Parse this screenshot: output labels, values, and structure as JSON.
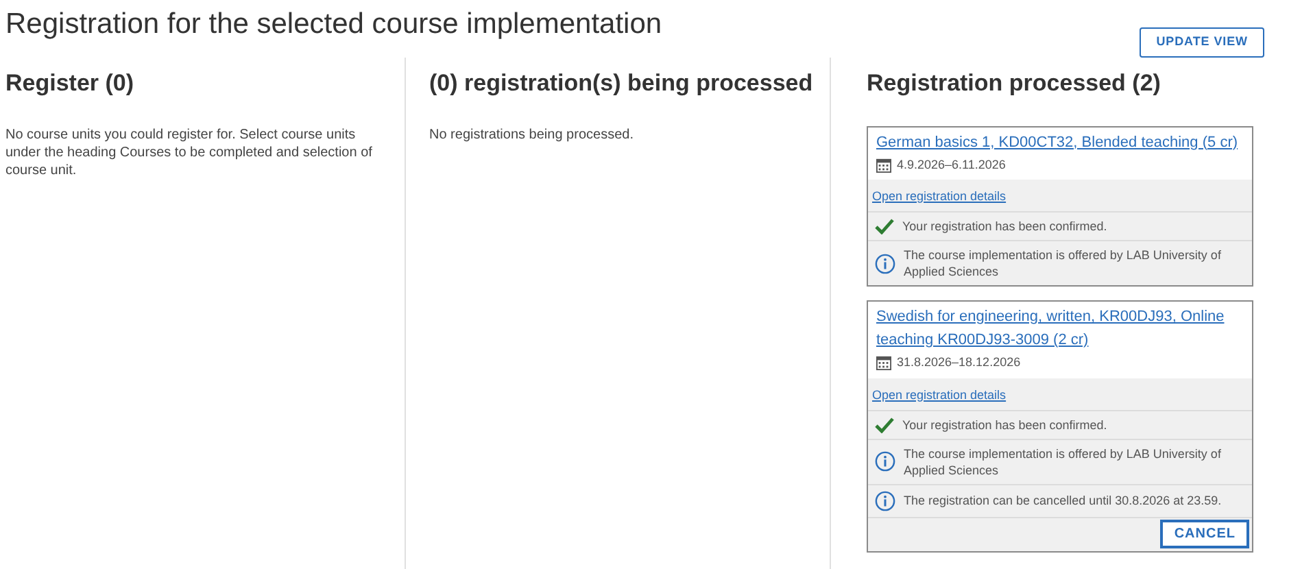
{
  "page_title": "Registration for the selected course implementation",
  "update_button": "UPDATE VIEW",
  "columns": [
    {
      "heading": "Register (0)",
      "message": "No course units you could register for. Select course units under the heading Courses to be completed and selection of course unit."
    },
    {
      "heading": "(0) registration(s) being processed",
      "message": "No registrations being processed."
    },
    {
      "heading": "Registration processed (2)",
      "cards": [
        {
          "title": "German basics 1, KD00CT32, Blended teaching (5 cr)",
          "dates": "4.9.2026–6.11.2026",
          "details_link": "Open registration details",
          "notes": [
            {
              "kind": "confirmed",
              "text": "Your registration has been confirmed."
            },
            {
              "kind": "info",
              "text": "The course implementation is offered by LAB University of Applied Sciences"
            }
          ]
        },
        {
          "title": "Swedish for engineering, written, KR00DJ93, Online teaching KR00DJ93-3009 (2 cr)",
          "dates": "31.8.2026–18.12.2026",
          "details_link": "Open registration details",
          "notes": [
            {
              "kind": "confirmed",
              "text": "Your registration has been confirmed."
            },
            {
              "kind": "info",
              "text": "The course implementation is offered by LAB University of Applied Sciences"
            },
            {
              "kind": "info",
              "text": "The registration can be cancelled until 30.8.2026 at 23.59."
            }
          ],
          "cancel_button": "CANCEL"
        }
      ]
    }
  ]
}
